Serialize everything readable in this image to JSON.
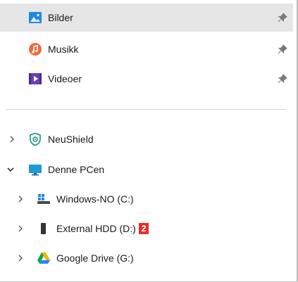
{
  "quick_access": [
    {
      "label": "Bilder",
      "icon": "pictures-icon",
      "selected": true
    },
    {
      "label": "Musikk",
      "icon": "music-icon"
    },
    {
      "label": "Videoer",
      "icon": "videos-icon"
    }
  ],
  "tree": {
    "neushield": {
      "label": "NeuShield",
      "icon": "shield-icon"
    },
    "this_pc": {
      "label": "Denne PCen",
      "icon": "monitor-icon"
    },
    "drives": [
      {
        "label": "Windows-NO (C:)",
        "icon": "windows-drive-icon"
      },
      {
        "label": "External HDD (D:)",
        "icon": "external-drive-icon",
        "badge": "2"
      },
      {
        "label": "Google Drive (G:)",
        "icon": "google-drive-icon"
      }
    ]
  },
  "colors": {
    "selection": "#e6e6e6",
    "badge": "#e0312f",
    "accent": "#1e88e5"
  }
}
